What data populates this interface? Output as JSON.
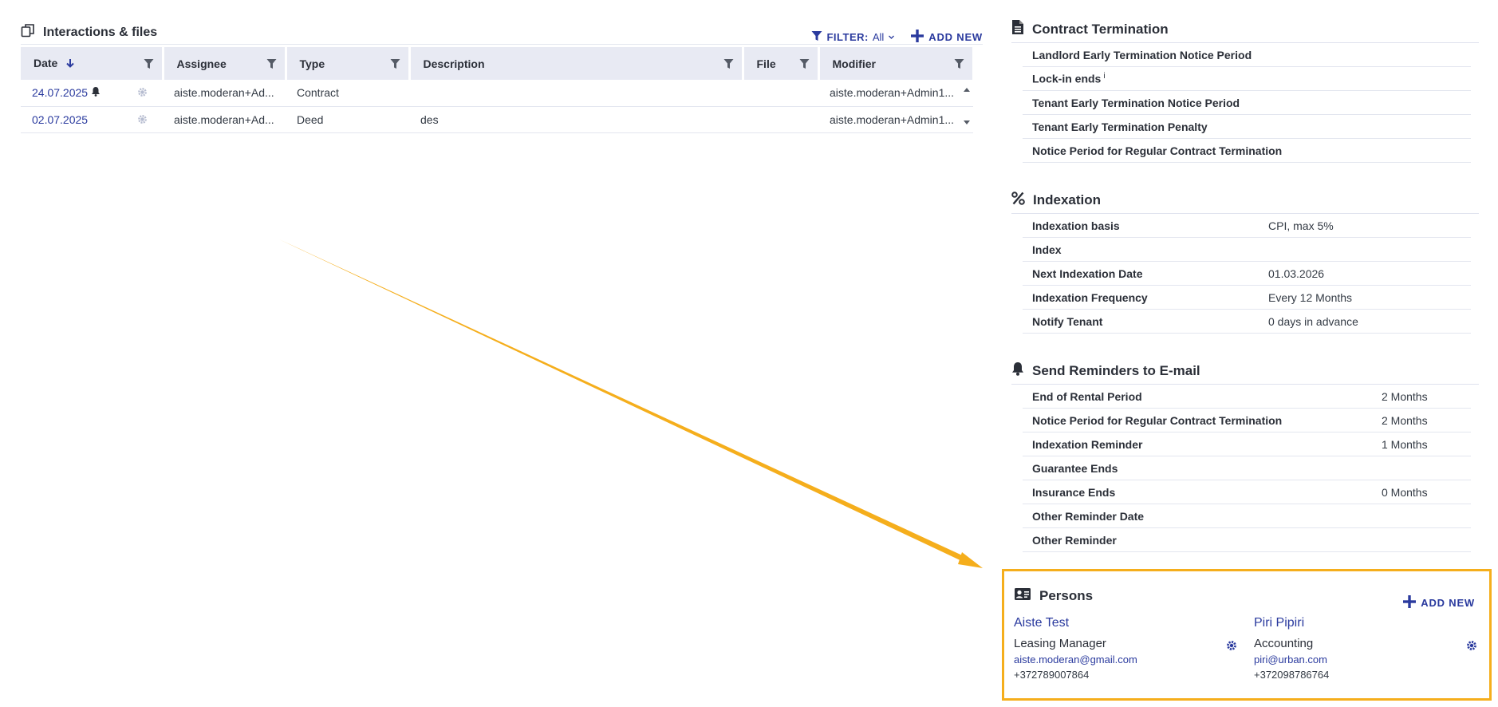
{
  "interactions": {
    "title": "Interactions & files",
    "filter_label": "FILTER:",
    "filter_value": "All",
    "add_new": "ADD NEW",
    "columns": {
      "date": "Date",
      "assignee": "Assignee",
      "type": "Type",
      "description": "Description",
      "file": "File",
      "modifier": "Modifier"
    },
    "rows": [
      {
        "date": "24.07.2025",
        "assignee": "aiste.moderan+Ad...",
        "type": "Contract",
        "description": "",
        "file": "",
        "modifier": "aiste.moderan+Admin1..."
      },
      {
        "date": "02.07.2025",
        "assignee": "aiste.moderan+Ad...",
        "type": "Deed",
        "description": "des",
        "file": "",
        "modifier": "aiste.moderan+Admin1..."
      }
    ]
  },
  "contract_termination": {
    "title": "Contract Termination",
    "items": [
      {
        "label": "Landlord Early Termination Notice Period",
        "value": ""
      },
      {
        "label": "Lock-in ends",
        "sup": "i",
        "value": ""
      },
      {
        "label": "Tenant Early Termination Notice Period",
        "value": ""
      },
      {
        "label": "Tenant Early Termination Penalty",
        "value": ""
      },
      {
        "label": "Notice Period for Regular Contract Termination",
        "value": ""
      }
    ]
  },
  "indexation": {
    "title": "Indexation",
    "items": [
      {
        "label": "Indexation basis",
        "value": "CPI, max 5%"
      },
      {
        "label": "Index",
        "value": ""
      },
      {
        "label": "Next Indexation Date",
        "value": "01.03.2026"
      },
      {
        "label": "Indexation Frequency",
        "value": "Every 12 Months"
      },
      {
        "label": "Notify Tenant",
        "value": "0 days in advance"
      }
    ]
  },
  "reminders": {
    "title": "Send Reminders to E-mail",
    "items": [
      {
        "label": "End of Rental Period",
        "value": "2 Months"
      },
      {
        "label": "Notice Period for Regular Contract Termination",
        "value": "2 Months"
      },
      {
        "label": "Indexation Reminder",
        "value": "1 Months"
      },
      {
        "label": "Guarantee Ends",
        "value": ""
      },
      {
        "label": "Insurance Ends",
        "value": "0 Months"
      },
      {
        "label": "Other Reminder Date",
        "value": ""
      },
      {
        "label": "Other Reminder",
        "value": ""
      }
    ]
  },
  "persons": {
    "title": "Persons",
    "add_new": "ADD NEW",
    "list": [
      {
        "name": "Aiste Test",
        "role": "Leasing Manager",
        "email": "aiste.moderan@gmail.com",
        "phone": "+372789007864"
      },
      {
        "name": "Piri Pipiri",
        "role": "Accounting",
        "email": "piri@urban.com",
        "phone": "+372098786764"
      }
    ]
  },
  "colors": {
    "accent": "#2a3a9e",
    "highlight": "#f5ae1c",
    "header_bg": "#e8eaf3"
  },
  "icons": [
    "copy-files-icon",
    "filter-icon",
    "plus-icon",
    "sort-arrow-down-icon",
    "bell-icon",
    "gear-icon",
    "document-icon",
    "percent-icon",
    "id-card-icon",
    "scroll-up-icon",
    "scroll-down-icon"
  ]
}
